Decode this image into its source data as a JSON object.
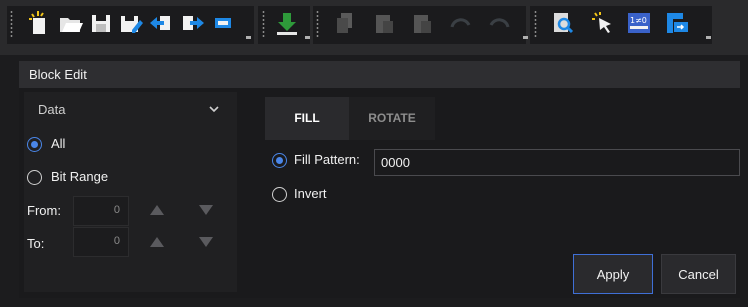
{
  "toolbar": {
    "buttons": [
      {
        "name": "new-file-icon"
      },
      {
        "name": "open-folder-icon"
      },
      {
        "name": "save-icon"
      },
      {
        "name": "save-as-icon"
      },
      {
        "name": "import-icon"
      },
      {
        "name": "export-icon"
      },
      {
        "name": "download-icon"
      },
      {
        "name": "copy-icon",
        "disabled": true
      },
      {
        "name": "paste-icon",
        "disabled": true
      },
      {
        "name": "paste-special-icon",
        "disabled": true
      },
      {
        "name": "undo-icon",
        "disabled": true
      },
      {
        "name": "redo-icon",
        "disabled": true
      },
      {
        "name": "find-icon"
      },
      {
        "name": "select-pointer-icon"
      },
      {
        "name": "binary-edit-icon"
      },
      {
        "name": "hex-view-icon"
      }
    ],
    "colors": {
      "accent_blue": "#1e88e5",
      "accent_green": "#2e9a3a",
      "disabled": "#5a5a5a"
    }
  },
  "dialog": {
    "title": "Block Edit"
  },
  "left": {
    "select_value": "Data",
    "radio_all": "All",
    "radio_bit_range": "Bit Range",
    "from_label": "From:",
    "from_value": "0",
    "to_label": "To:",
    "to_value": "0"
  },
  "tabs": [
    {
      "label": "FILL",
      "active": true
    },
    {
      "label": "ROTATE",
      "active": false
    }
  ],
  "fill": {
    "pattern_label": "Fill Pattern:",
    "pattern_value": "0000",
    "invert_label": "Invert"
  },
  "actions": {
    "apply_label": "Apply",
    "cancel_label": "Cancel"
  }
}
